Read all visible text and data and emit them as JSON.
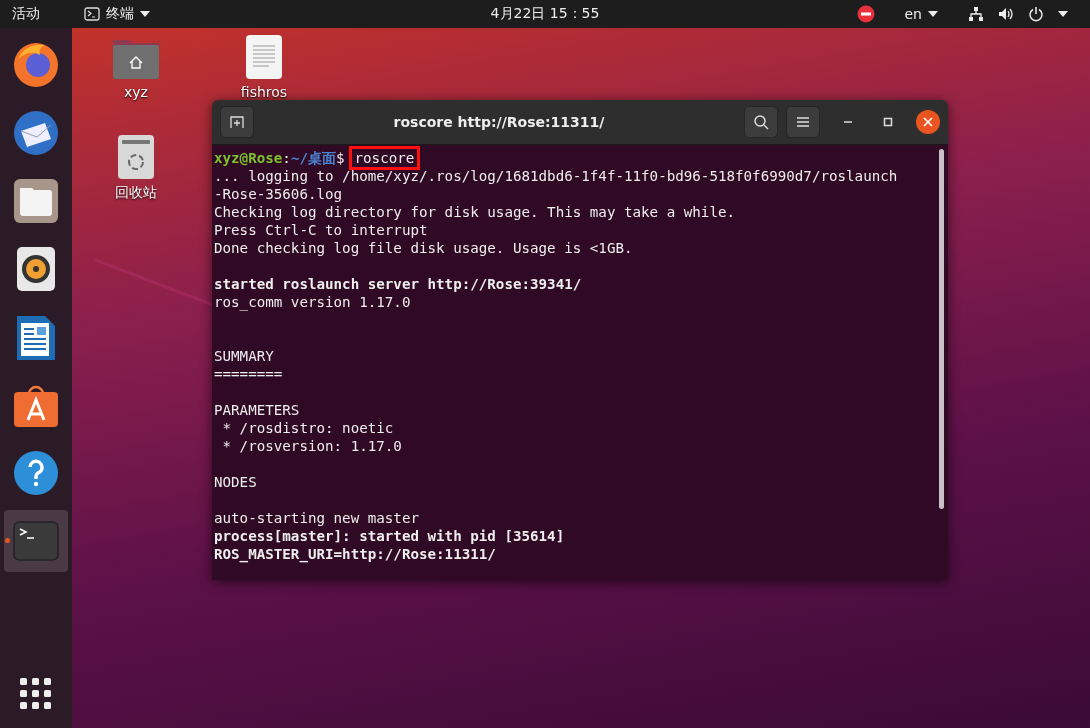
{
  "top_bar": {
    "activities": "活动",
    "app_menu": "终端",
    "clock": "4月22日  15：55",
    "input_method": "en"
  },
  "dock": [
    {
      "kind": "browser",
      "running": false
    },
    {
      "kind": "mail",
      "running": false
    },
    {
      "kind": "files",
      "running": false
    },
    {
      "kind": "music",
      "running": false
    },
    {
      "kind": "writer",
      "running": false
    },
    {
      "kind": "software",
      "running": false
    },
    {
      "kind": "help",
      "running": false
    },
    {
      "kind": "terminal",
      "running": true
    }
  ],
  "desktop_icons": [
    {
      "kind": "home",
      "label": "xyz"
    },
    {
      "kind": "document",
      "label": "fishros"
    },
    {
      "kind": "trash",
      "label": "回收站"
    }
  ],
  "terminal": {
    "title": "roscore http://Rose:11311/",
    "prompt": {
      "user": "xyz@Rose",
      "separator": ":",
      "path": "~/桌面",
      "symbol": "$",
      "command": "roscore",
      "command_highlighted": true
    },
    "lines": [
      {
        "kind": "normal",
        "text": "... logging to /home/xyz/.ros/log/1681dbd6-1f4f-11f0-bd96-518f0f6990d7/roslaunch"
      },
      {
        "kind": "normal",
        "text": "-Rose-35606.log"
      },
      {
        "kind": "normal",
        "text": "Checking log directory for disk usage. This may take a while."
      },
      {
        "kind": "normal",
        "text": "Press Ctrl-C to interrupt"
      },
      {
        "kind": "normal",
        "text": "Done checking log file disk usage. Usage is <1GB."
      },
      {
        "kind": "blank"
      },
      {
        "kind": "bold",
        "text": "started roslaunch server http://Rose:39341/"
      },
      {
        "kind": "normal",
        "text": "ros_comm version 1.17.0"
      },
      {
        "kind": "blank"
      },
      {
        "kind": "blank"
      },
      {
        "kind": "normal",
        "text": "SUMMARY"
      },
      {
        "kind": "normal",
        "text": "========"
      },
      {
        "kind": "blank"
      },
      {
        "kind": "normal",
        "text": "PARAMETERS"
      },
      {
        "kind": "normal",
        "text": " * /rosdistro: noetic"
      },
      {
        "kind": "normal",
        "text": " * /rosversion: 1.17.0"
      },
      {
        "kind": "blank"
      },
      {
        "kind": "normal",
        "text": "NODES"
      },
      {
        "kind": "blank"
      },
      {
        "kind": "normal",
        "text": "auto-starting new master"
      },
      {
        "kind": "bold",
        "text": "process[master]: started with pid [35614]"
      },
      {
        "kind": "bold",
        "text": "ROS_MASTER_URI=http://Rose:11311/"
      }
    ]
  }
}
